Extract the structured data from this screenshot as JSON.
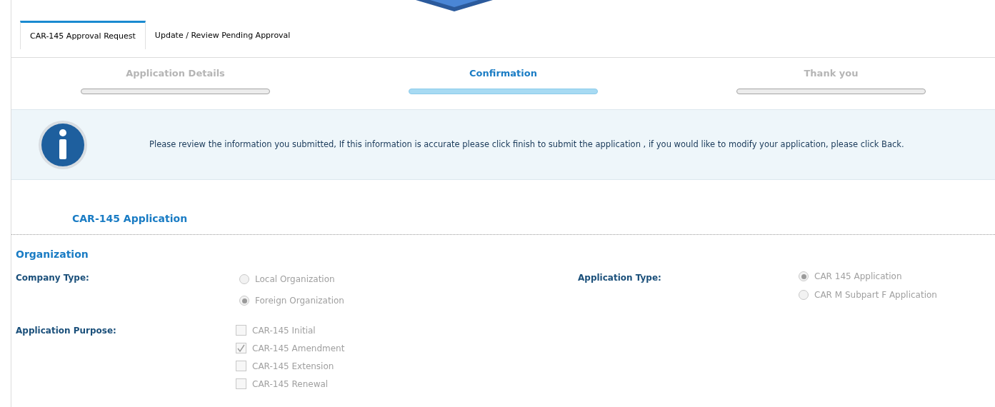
{
  "tabs": [
    {
      "label": "CAR-145 Approval Request",
      "selected": true
    },
    {
      "label": "Update / Review Pending Approval",
      "selected": false
    }
  ],
  "steps": [
    {
      "label": "Application Details",
      "selected": false
    },
    {
      "label": "Confirmation",
      "selected": true
    },
    {
      "label": "Thank you",
      "selected": false
    }
  ],
  "info_message": "Please review the information you submitted, If this information is accurate please click finish to submit the application , if you would like to modify your application, please click Back.",
  "form_title": "CAR-145 Application",
  "section_title": "Organization",
  "company_type": {
    "label": "Company Type:",
    "options": [
      {
        "label": "Local Organization",
        "selected": false
      },
      {
        "label": "Foreign Organization",
        "selected": true
      }
    ]
  },
  "application_type": {
    "label": "Application Type:",
    "options": [
      {
        "label": "CAR 145 Application",
        "selected": true
      },
      {
        "label": "CAR M Subpart F Application",
        "selected": false
      }
    ]
  },
  "application_purpose": {
    "label": "Application Purpose:",
    "options": [
      {
        "label": "CAR-145 Initial",
        "checked": false
      },
      {
        "label": "CAR-145 Amendment",
        "checked": true
      },
      {
        "label": "CAR-145 Extension",
        "checked": false
      },
      {
        "label": "CAR-145 Renewal",
        "checked": false
      }
    ]
  }
}
